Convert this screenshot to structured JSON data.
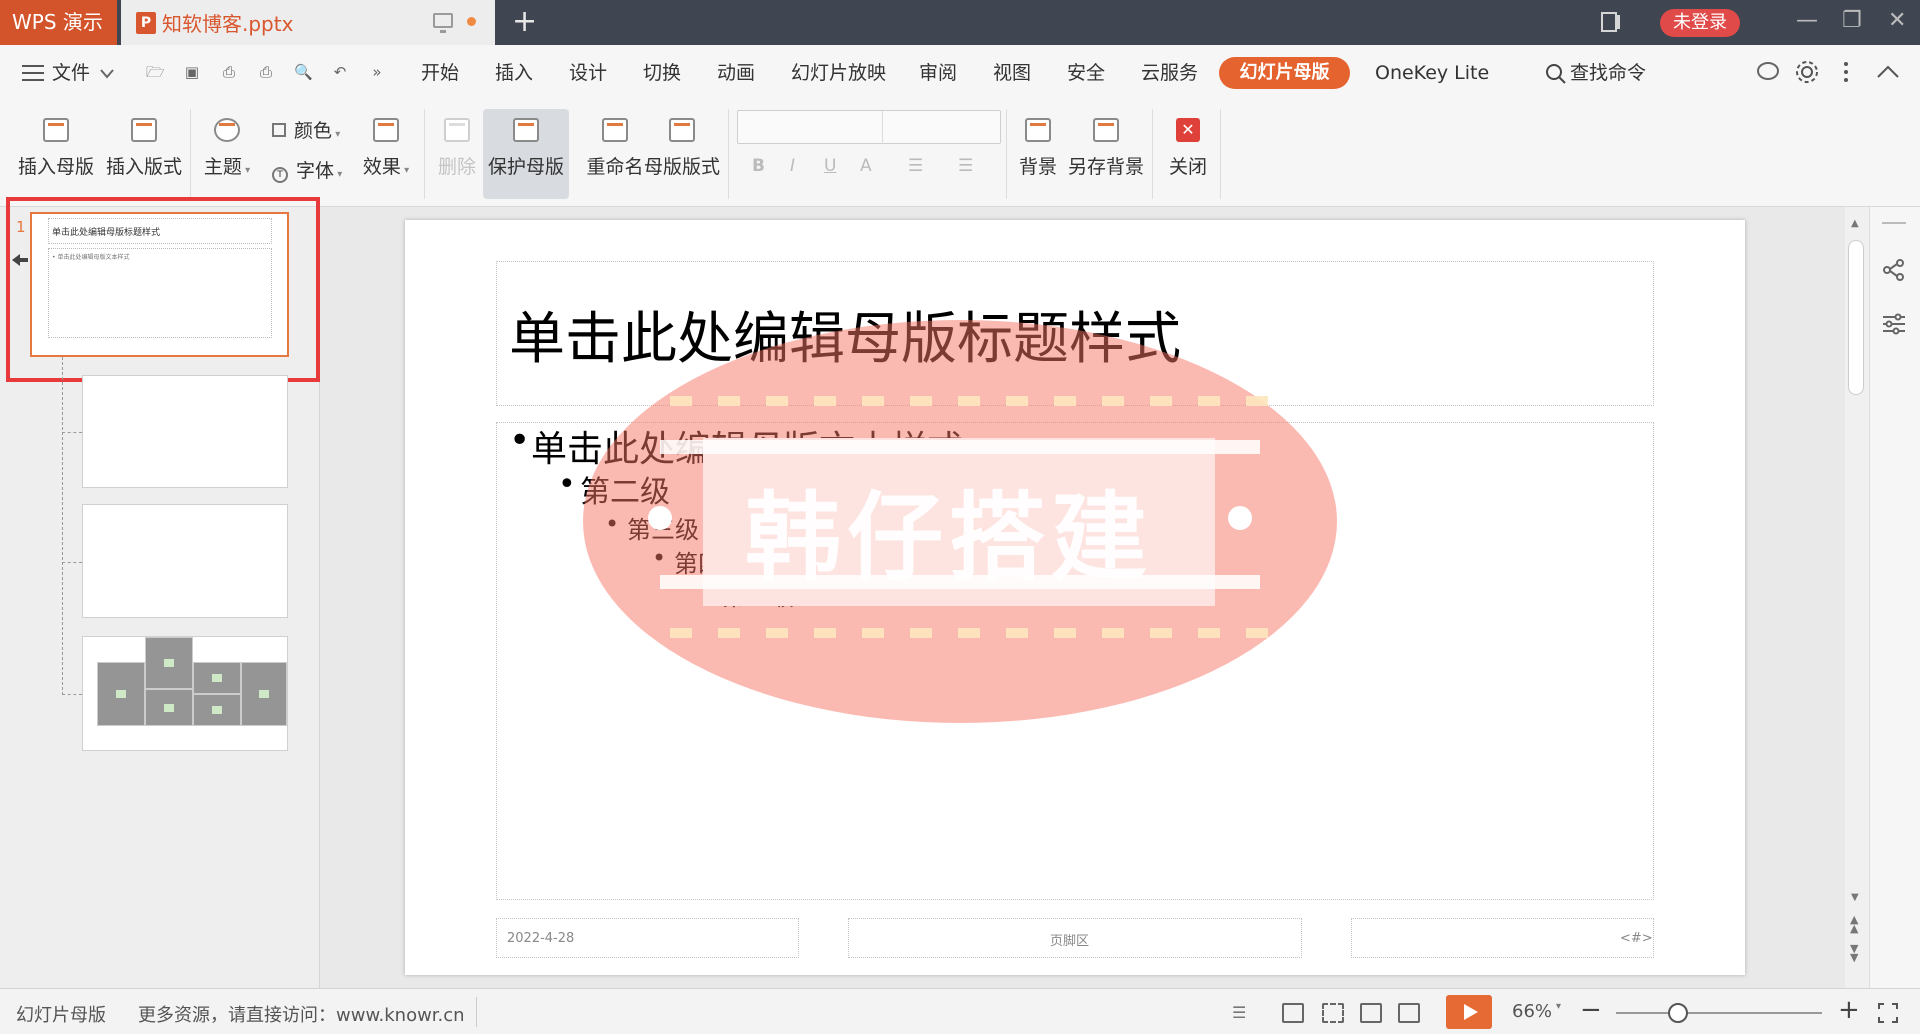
{
  "titlebar": {
    "app_name": "WPS 演示",
    "doc_icon": "P",
    "doc_name": "知软博客.pptx",
    "new_tab": "+",
    "login_label": "未登录",
    "win_min": "—",
    "win_restore": "❐",
    "win_close": "✕"
  },
  "menubar": {
    "file_label": "文件",
    "items": [
      "开始",
      "插入",
      "设计",
      "切换",
      "动画",
      "幻灯片放映",
      "审阅",
      "视图",
      "安全",
      "云服务",
      "幻灯片母版",
      "OneKey Lite"
    ],
    "active_index": 10,
    "search_label": "查找命令",
    "accent": "#e5632f"
  },
  "ribbon": {
    "insert_master": "插入母版",
    "insert_layout": "插入版式",
    "theme": "主题",
    "color": "颜色",
    "font": "字体",
    "effect": "效果",
    "delete": "删除",
    "protect_master": "保护母版",
    "rename": "重命名",
    "master_layout": "母版版式",
    "fmt_bold": "B",
    "fmt_italic": "I",
    "fmt_underline": "U",
    "fmt_color": "A",
    "background": "背景",
    "save_background": "另存背景",
    "close": "关闭"
  },
  "thumbnails": {
    "current_number": "1",
    "t1_title": "单击此处编辑母版标题样式",
    "t1_body": "• 单击此处编辑母版文本样式"
  },
  "slide": {
    "title": "单击此处编辑母版标题样式",
    "levels": [
      "单击此处编辑母版文本样式",
      "第二级",
      "第三级",
      "第四级",
      "第五级"
    ],
    "footer_date": "2022-4-28",
    "footer_center": "页脚区",
    "footer_number": "<#>",
    "watermark_text": "韩仔搭建",
    "watermark_color": "#f77564"
  },
  "statusbar": {
    "mode": "幻灯片母版",
    "resources": "更多资源，请直接访问：www.knowr.cn",
    "zoom": "66%",
    "zoom_fraction": 0.66,
    "zoom_minus": "−",
    "zoom_plus": "+"
  }
}
